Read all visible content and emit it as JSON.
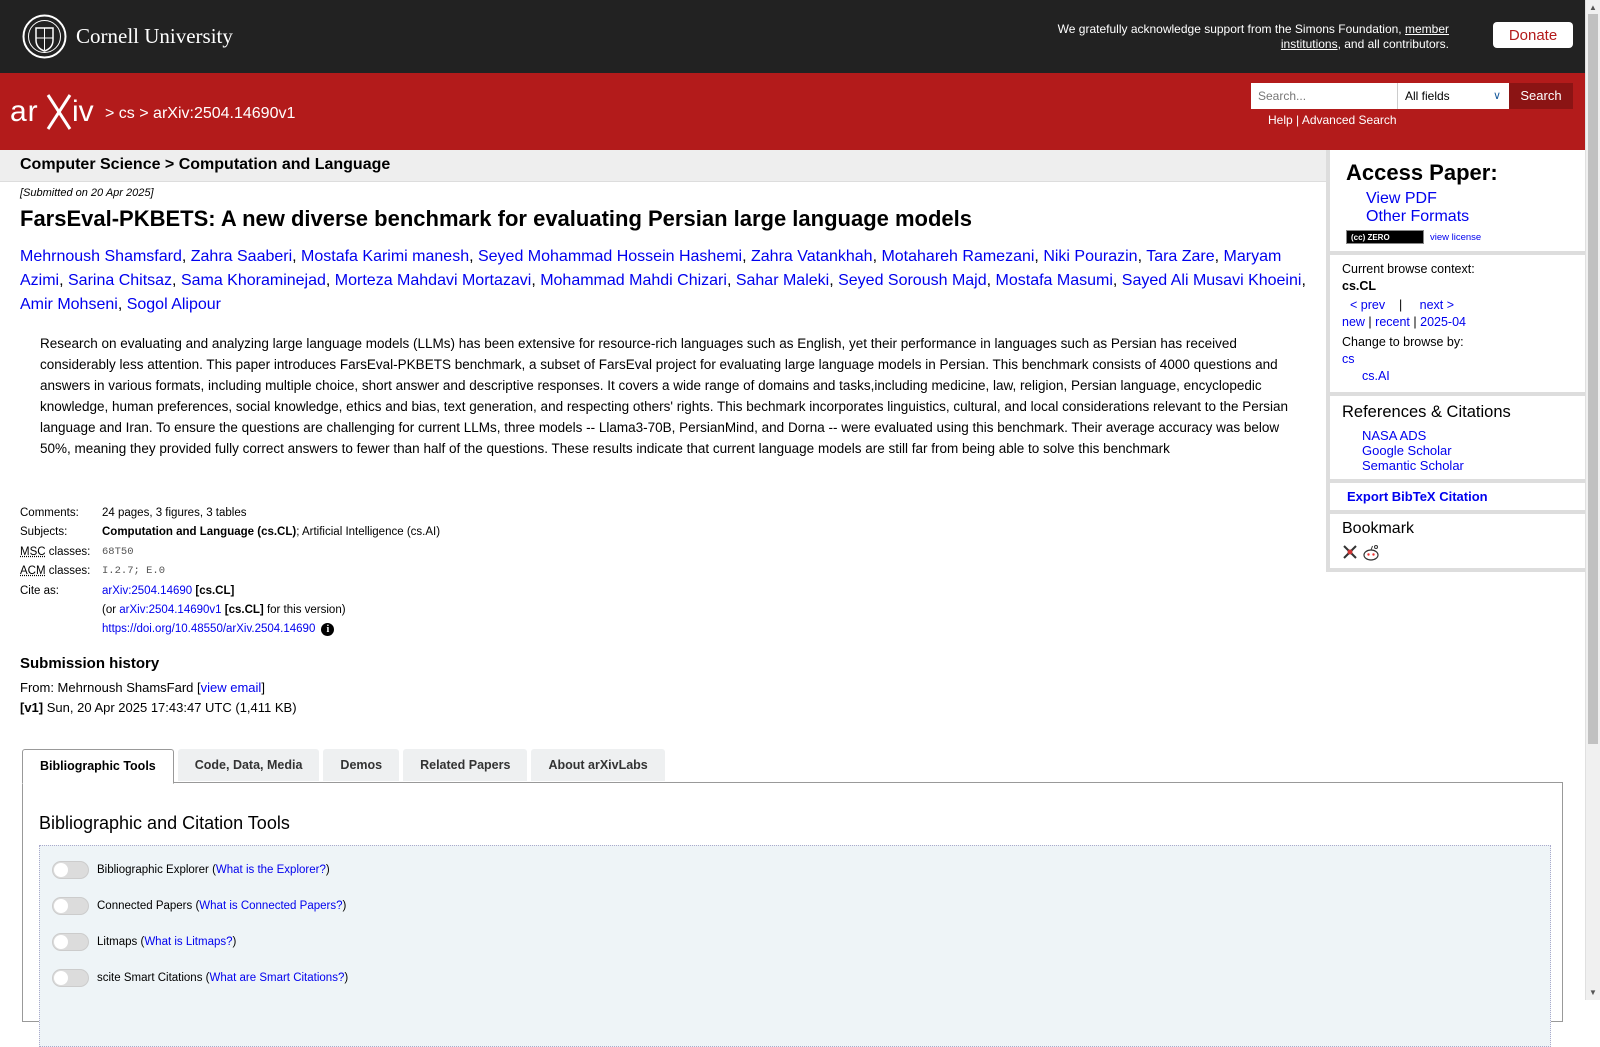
{
  "header": {
    "university": "Cornell University",
    "support_text_1": "We gratefully acknowledge support from the Simons Foundation,",
    "support_link": "member institutions",
    "support_text_2": ", and all contributors.",
    "donate": "Donate"
  },
  "nav": {
    "sep1": ">",
    "cs": "cs",
    "sep2": ">",
    "paper_id": "arXiv:2504.14690v1",
    "search_placeholder": "Search...",
    "field_select": "All fields",
    "search_button": "Search",
    "help": "Help",
    "advanced": "Advanced Search",
    "divider": "|"
  },
  "category_header": "Computer Science > Computation and Language",
  "submitted": "[Submitted on 20 Apr 2025]",
  "title": "FarsEval-PKBETS: A new diverse benchmark for evaluating Persian large language models",
  "authors": [
    "Mehrnoush Shamsfard",
    "Zahra Saaberi",
    "Mostafa Karimi manesh",
    "Seyed Mohammad Hossein Hashemi",
    "Zahra Vatankhah",
    "Motahareh Ramezani",
    "Niki Pourazin",
    "Tara Zare",
    "Maryam Azimi",
    "Sarina Chitsaz",
    "Sama Khoraminejad",
    "Morteza Mahdavi Mortazavi",
    "Mohammad Mahdi Chizari",
    "Sahar Maleki",
    "Seyed Soroush Majd",
    "Mostafa Masumi",
    "Sayed Ali Musavi Khoeini",
    "Amir Mohseni",
    "Sogol Alipour"
  ],
  "abstract": "Research on evaluating and analyzing large language models (LLMs) has been extensive for resource-rich languages such as English, yet their performance in languages such as Persian has received considerably less attention. This paper introduces FarsEval-PKBETS benchmark, a subset of FarsEval project for evaluating large language models in Persian. This benchmark consists of 4000 questions and answers in various formats, including multiple choice, short answer and descriptive responses. It covers a wide range of domains and tasks,including medicine, law, religion, Persian language, encyclopedic knowledge, human preferences, social knowledge, ethics and bias, text generation, and respecting others' rights. This bechmark incorporates linguistics, cultural, and local considerations relevant to the Persian language and Iran. To ensure the questions are challenging for current LLMs, three models -- Llama3-70B, PersianMind, and Dorna -- were evaluated using this benchmark. Their average accuracy was below 50%, meaning they provided fully correct answers to fewer than half of the questions. These results indicate that current language models are still far from being able to solve this benchmark",
  "meta": {
    "comments_label": "Comments:",
    "comments": "24 pages, 3 figures, 3 tables",
    "subjects_label": "Subjects:",
    "subjects_primary": "Computation and Language (cs.CL)",
    "subjects_rest": "; Artificial Intelligence (cs.AI)",
    "msc_abbr": "MSC",
    "msc_label_rest": " classes:",
    "msc": "68T50",
    "acm_abbr": "ACM",
    "acm_label_rest": " classes:",
    "acm": "I.2.7; E.0",
    "cite_label": "Cite as:",
    "cite_id": "arXiv:2504.14690",
    "cite_cat": "[cs.CL]",
    "or_text": "(or ",
    "cite_version": "arXiv:2504.14690v1",
    "version_cat": "[cs.CL]",
    "version_suffix": " for this version)",
    "doi": "https://doi.org/10.48550/arXiv.2504.14690",
    "info_icon": "i"
  },
  "history": {
    "title": "Submission history",
    "from": "From: Mehrnoush ShamsFard [",
    "view_email": "view email",
    "close": "]",
    "v1": "[v1]",
    "v1_text": " Sun, 20 Apr 2025 17:43:47 UTC (1,411 KB)"
  },
  "tabs": [
    "Bibliographic Tools",
    "Code, Data, Media",
    "Demos",
    "Related Papers",
    "About arXivLabs"
  ],
  "panel": {
    "title": "Bibliographic and Citation Tools",
    "tools": [
      {
        "name": "Bibliographic Explorer",
        "link": "What is the Explorer?"
      },
      {
        "name": "Connected Papers",
        "link": "What is Connected Papers?"
      },
      {
        "name": "Litmaps",
        "link": "What is Litmaps?"
      },
      {
        "name": "scite Smart Citations",
        "link": "What are Smart Citations?"
      }
    ]
  },
  "sidebar": {
    "access_title": "Access Paper:",
    "view_pdf": "View PDF",
    "other_formats": "Other Formats",
    "cc_badge": "(cc) ZERO",
    "view_license": "view license",
    "context_label": "Current browse context:",
    "context": "cs.CL",
    "prev": "< prev",
    "pipe": "|",
    "next": "next >",
    "new": "new",
    "recent": "recent",
    "month": "2025-04",
    "change_label": "Change to browse by:",
    "browse_cs": "cs",
    "browse_csai": "cs.AI",
    "refs_title": "References & Citations",
    "nasa": "NASA ADS",
    "google": "Google Scholar",
    "semantic": "Semantic Scholar",
    "export": "Export BibTeX Citation",
    "bookmark": "Bookmark"
  },
  "colors": {
    "arxiv_red": "#b31b1b",
    "topbar": "#222222",
    "link": "#0000ee"
  }
}
